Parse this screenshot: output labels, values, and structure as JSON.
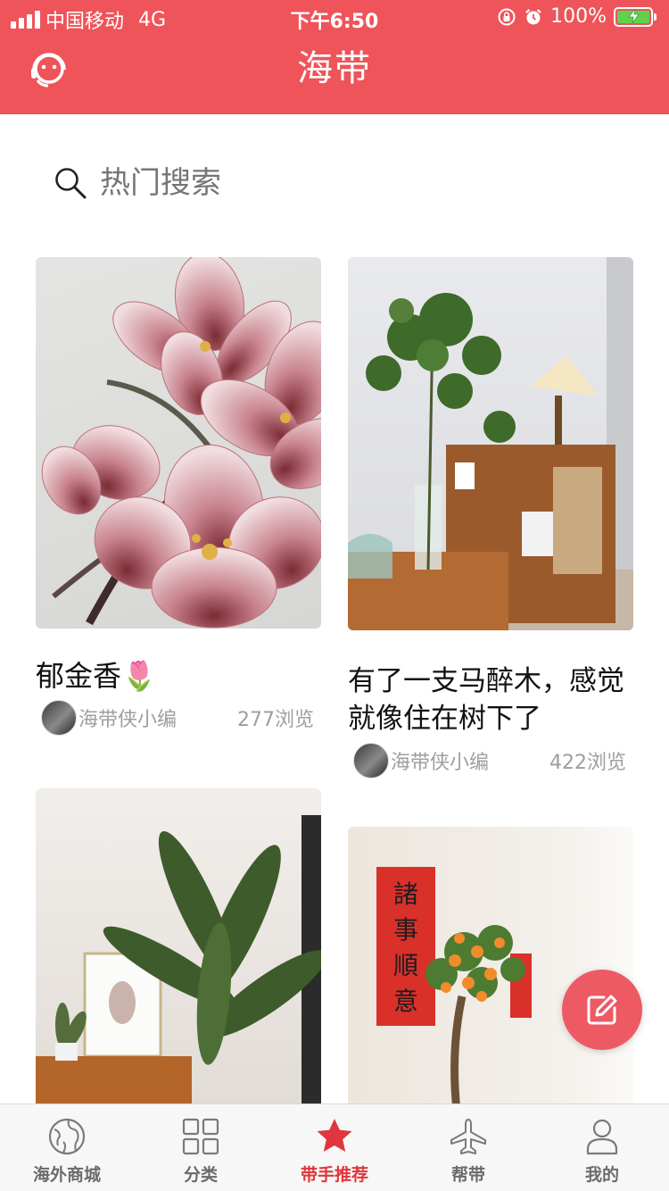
{
  "status_bar": {
    "carrier": "中国移动",
    "network": "4G",
    "time": "下午6:50",
    "battery_percent": "100%",
    "signal_bars": 4,
    "battery_level": 1.0
  },
  "header": {
    "title": "海带",
    "left_icon": "customer-service-icon"
  },
  "search": {
    "placeholder": "热门搜索",
    "icon": "search-icon"
  },
  "feed": [
    {
      "title": "郁金香🌷",
      "author": "海带侠小编",
      "views": "277浏览",
      "image": "pink-tulips-photo"
    },
    {
      "title": "有了一支马醉木，感觉就像住在树下了",
      "author": "海带侠小编",
      "views": "422浏览",
      "image": "plant-and-lamp-photo"
    },
    {
      "title": "",
      "author": "",
      "views": "",
      "image": "bird-of-paradise-plant-photo"
    },
    {
      "title": "",
      "author": "",
      "views": "",
      "image": "kumquat-tree-photo"
    }
  ],
  "fab": {
    "icon": "edit-icon"
  },
  "tabs": [
    {
      "label": "海外商城",
      "icon": "globe-icon",
      "active": false
    },
    {
      "label": "分类",
      "icon": "grid-icon",
      "active": false
    },
    {
      "label": "带手推荐",
      "icon": "star-icon",
      "active": true
    },
    {
      "label": "帮带",
      "icon": "airplane-icon",
      "active": false
    },
    {
      "label": "我的",
      "icon": "person-icon",
      "active": false
    }
  ],
  "colors": {
    "brand": "#ee5459",
    "active_tab": "#e0363d",
    "muted_text": "#9e9e9e"
  }
}
